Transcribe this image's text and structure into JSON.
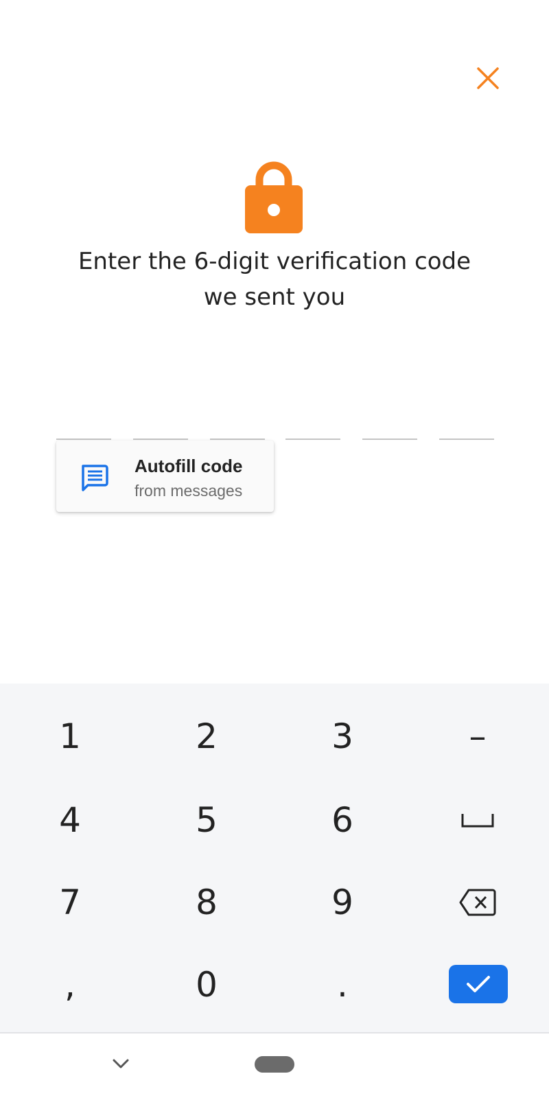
{
  "header": {
    "close_icon": "close-icon",
    "accent_color": "#f5821f"
  },
  "hero": {
    "icon": "lock-icon",
    "title_line1": "Enter the 6-digit verification code",
    "title_line2": "we sent you"
  },
  "code_input": {
    "digits": [
      "",
      "",
      "",
      "",
      "",
      ""
    ]
  },
  "autofill": {
    "icon": "message-icon",
    "title": "Autofill code",
    "subtitle": "from messages",
    "icon_color": "#1a73e8"
  },
  "keyboard": {
    "keys": [
      {
        "label": "1"
      },
      {
        "label": "2"
      },
      {
        "label": "3"
      },
      {
        "label": "–"
      },
      {
        "label": "4"
      },
      {
        "label": "5"
      },
      {
        "label": "6"
      },
      {
        "label": "␣",
        "icon": "space-icon"
      },
      {
        "label": "7"
      },
      {
        "label": "8"
      },
      {
        "label": "9"
      },
      {
        "label": "",
        "icon": "backspace-icon"
      },
      {
        "label": ","
      },
      {
        "label": "0"
      },
      {
        "label": "."
      },
      {
        "label": "",
        "icon": "done-check-icon"
      }
    ],
    "done_color": "#1a73e8"
  },
  "navbar": {
    "back_icon": "chevron-down-icon",
    "home_icon": "home-pill-icon"
  }
}
